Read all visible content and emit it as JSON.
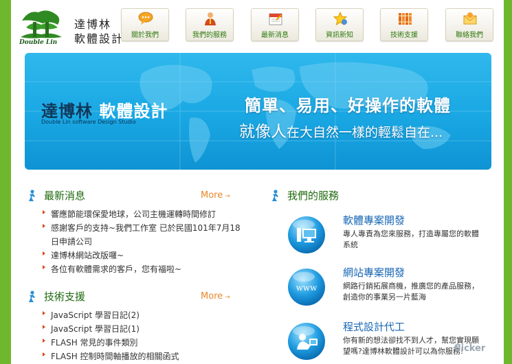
{
  "header": {
    "logo_name_line1": "達博林",
    "logo_name_line2": "軟體設計",
    "logo_sub": "Double Lin"
  },
  "nav": [
    {
      "label": "關於我們",
      "icon": "chat-bubble-icon"
    },
    {
      "label": "我們的服務",
      "icon": "person-icon"
    },
    {
      "label": "最新消息",
      "icon": "calendar-icon"
    },
    {
      "label": "資訊新知",
      "icon": "star-icon"
    },
    {
      "label": "技術支援",
      "icon": "books-icon"
    },
    {
      "label": "聯絡我們",
      "icon": "envelope-icon"
    }
  ],
  "banner": {
    "brand_dark": "達博林",
    "brand_white": "軟體設計",
    "brand_sub": "Double Lin software Design Studio",
    "slogan_line1": "簡單、易用、好操作的軟體",
    "slogan_line2_prefix": "就像人",
    "slogan_line2_rest": "在大自然一樣的輕鬆自在..."
  },
  "news": {
    "title": "最新消息",
    "more": "More",
    "items": [
      "響應節能環保愛地球，公司主機運轉時間修訂",
      "感謝客戶的支持~我們工作室 已於民國101年7月18日申請公司",
      "達博林網站改版囉~",
      "各位有軟體需求的客戶，您有福啦~"
    ]
  },
  "support": {
    "title": "技術支援",
    "more": "More",
    "items": [
      "JavaScript 學習日記(2)",
      "JavaScript 學習日記(1)",
      "FLASH 常見的事件類別",
      "FLASH 控制時間軸播放的相關函式"
    ]
  },
  "services": {
    "title": "我們的服務",
    "items": [
      {
        "title": "軟體專案開發",
        "desc": "專人專責為您來服務，打造專屬您的軟體系統",
        "icon": "computer-icon"
      },
      {
        "title": "網站專案開發",
        "desc": "網路行銷拓展商機，推廣您的產品服務，創造你的事業另一片藍海",
        "icon": "www-icon",
        "icon_text": "www"
      },
      {
        "title": "程式設計代工",
        "desc": "你有新的想法卻找不到人才，幫您實現願望嗎?達博林軟體設計可以為你服務!",
        "icon": "programmer-icon"
      }
    ]
  },
  "watermark": "flicker"
}
